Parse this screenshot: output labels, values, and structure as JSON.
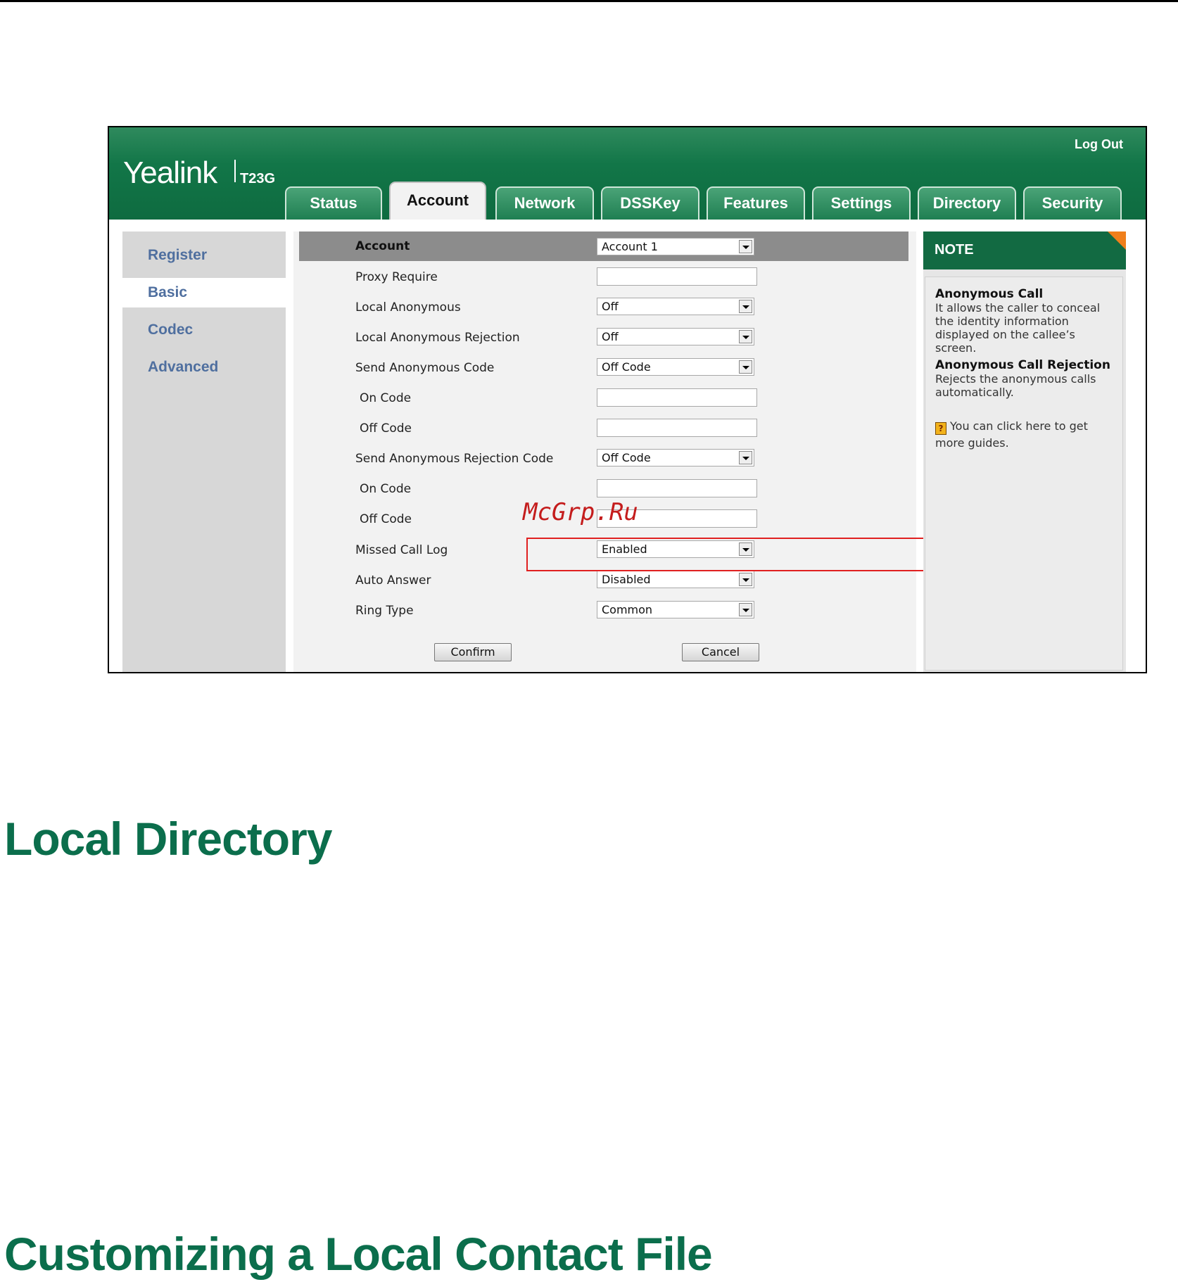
{
  "header": {
    "brand": "Yealink",
    "model": "T23G",
    "logout": "Log Out"
  },
  "tabs": [
    {
      "label": "Status"
    },
    {
      "label": "Account"
    },
    {
      "label": "Network"
    },
    {
      "label": "DSSKey"
    },
    {
      "label": "Features"
    },
    {
      "label": "Settings"
    },
    {
      "label": "Directory"
    },
    {
      "label": "Security"
    }
  ],
  "sidebar": {
    "items": [
      {
        "label": "Register"
      },
      {
        "label": "Basic"
      },
      {
        "label": "Codec"
      },
      {
        "label": "Advanced"
      }
    ]
  },
  "form": {
    "account_label": "Account",
    "account_value": "Account 1",
    "rows": [
      {
        "label": "Proxy Require",
        "value": ""
      },
      {
        "label": "Local Anonymous",
        "value": "Off"
      },
      {
        "label": "Local Anonymous Rejection",
        "value": "Off"
      },
      {
        "label": "Send Anonymous Code",
        "value": "Off Code"
      },
      {
        "label": "On Code",
        "value": ""
      },
      {
        "label": "Off Code",
        "value": ""
      },
      {
        "label": "Send Anonymous Rejection Code",
        "value": "Off Code"
      },
      {
        "label": "On Code",
        "value": ""
      },
      {
        "label": "Off Code",
        "value": ""
      },
      {
        "label": "Missed Call Log",
        "value": "Enabled"
      },
      {
        "label": "Auto Answer",
        "value": "Disabled"
      },
      {
        "label": "Ring Type",
        "value": "Common"
      }
    ],
    "confirm": "Confirm",
    "cancel": "Cancel"
  },
  "watermark": "McGrp.Ru",
  "note": {
    "title": "NOTE",
    "items": [
      {
        "title": "Anonymous Call",
        "text": "It allows the caller to conceal the identity information displayed on the callee’s screen."
      },
      {
        "title": "Anonymous Call Rejection",
        "text": "Rejects the anonymous calls automatically."
      }
    ],
    "help": "You can click here to get more guides."
  },
  "sections": {
    "local_directory": "Local Directory",
    "customizing": "Customizing a Local Contact File"
  },
  "colors": {
    "brand_green": "#127648",
    "heading_green": "#0b6e4c",
    "note_accent": "#f07f1b",
    "highlight": "#e02020"
  }
}
